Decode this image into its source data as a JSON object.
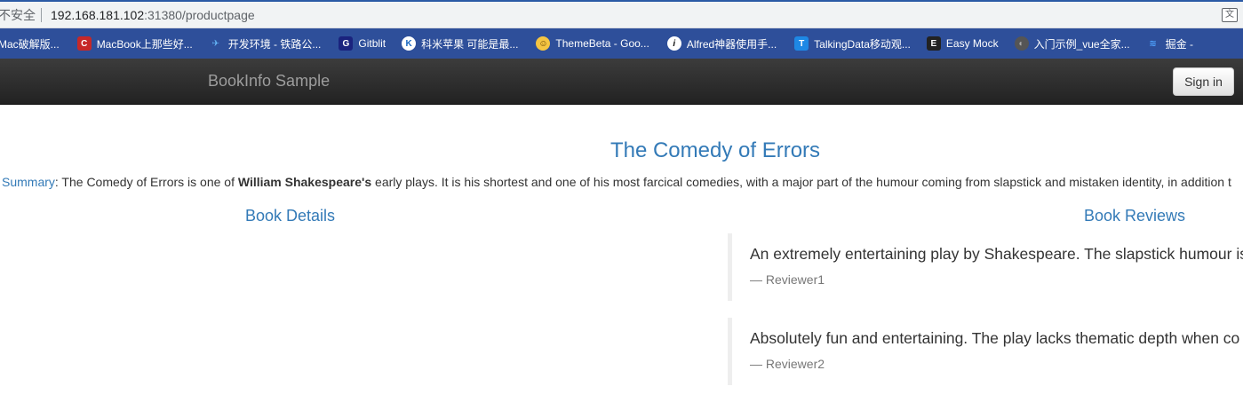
{
  "browser": {
    "insecure_label": "不安全",
    "url_host": "192.168.181.102",
    "url_path": ":31380/productpage",
    "translate_icon": "translate-icon"
  },
  "bookmarks": [
    {
      "label": "Mac破解版...",
      "icon": "",
      "color": ""
    },
    {
      "label": "MacBook上那些好...",
      "icon": "C",
      "color": "#c62828"
    },
    {
      "label": "开发环境 - 铁路公...",
      "icon": "✈",
      "color": "#1e88e5"
    },
    {
      "label": "Gitblit",
      "icon": "G",
      "color": "#283593"
    },
    {
      "label": "科米苹果 可能是最...",
      "icon": "K",
      "color": "#1565c0"
    },
    {
      "label": "ThemeBeta - Goo...",
      "icon": "☺",
      "color": "#e6a23c"
    },
    {
      "label": "Alfred神器使用手...",
      "icon": "i",
      "color": "#111111"
    },
    {
      "label": "TalkingData移动观...",
      "icon": "T",
      "color": "#1e88e5"
    },
    {
      "label": "Easy Mock",
      "icon": "E",
      "color": "#222222"
    },
    {
      "label": "入门示例_vue全家...",
      "icon": "◐",
      "color": "#555555"
    },
    {
      "label": "掘金 -",
      "icon": "≋",
      "color": "#1e6fff"
    }
  ],
  "navbar": {
    "brand": "BookInfo Sample",
    "signin_label": "Sign in"
  },
  "product": {
    "title": "The Comedy of Errors",
    "summary_label": "Summary",
    "summary_pre": ": The Comedy of Errors is one of ",
    "summary_bold": "William Shakespeare's",
    "summary_post": " early plays. It is his shortest and one of his most farcical comedies, with a major part of the humour coming from slapstick and mistaken identity, in addition t"
  },
  "details": {
    "heading": "Book Details"
  },
  "reviews": {
    "heading": "Book Reviews",
    "items": [
      {
        "text": "An extremely entertaining play by Shakespeare. The slapstick humour is",
        "author": "— Reviewer1"
      },
      {
        "text": "Absolutely fun and entertaining. The play lacks thematic depth when co",
        "author": "— Reviewer2"
      }
    ]
  }
}
